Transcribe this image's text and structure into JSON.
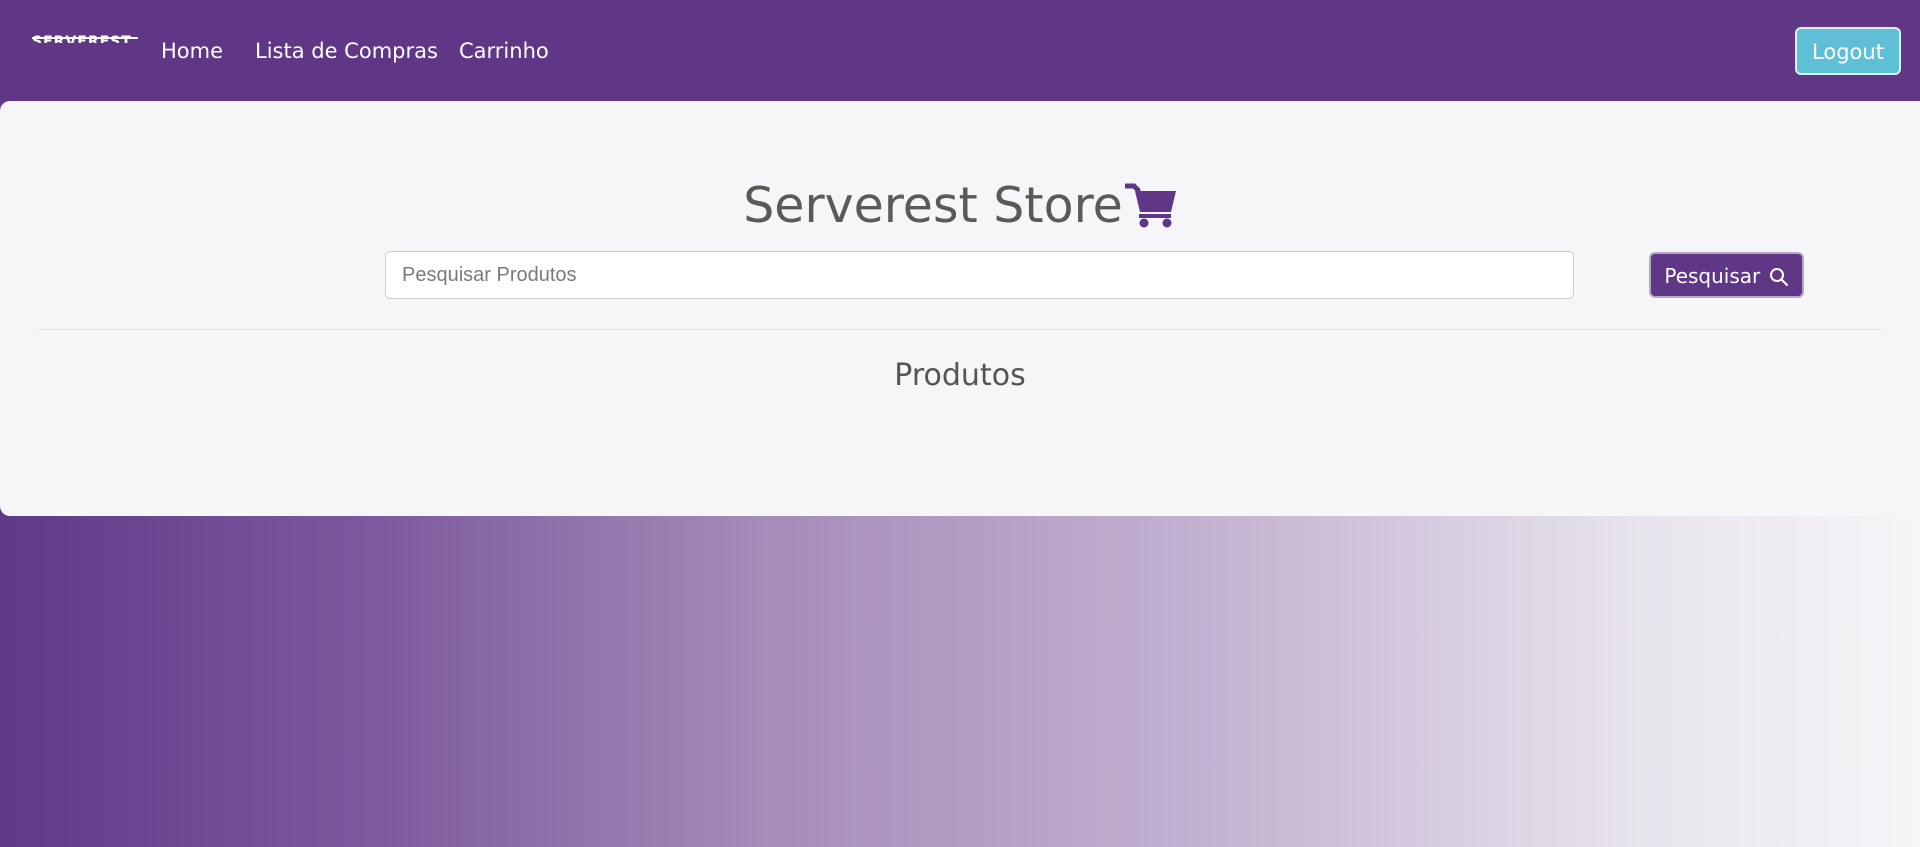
{
  "navbar": {
    "brand": "SERVEREST",
    "links": [
      {
        "label": "Home"
      },
      {
        "label": "Lista de Compras"
      },
      {
        "label": "Carrinho"
      }
    ],
    "logout_label": "Logout"
  },
  "main": {
    "store_title": "Serverest Store",
    "store_icon": "shopping-cart-icon",
    "search": {
      "placeholder": "Pesquisar Produtos",
      "value": "",
      "button_label": "Pesquisar",
      "button_icon": "search-icon"
    },
    "section_title": "Produtos"
  },
  "colors": {
    "primary": "#603786",
    "accent": "#5fbfd6",
    "card_background": "#f6f5f8"
  }
}
